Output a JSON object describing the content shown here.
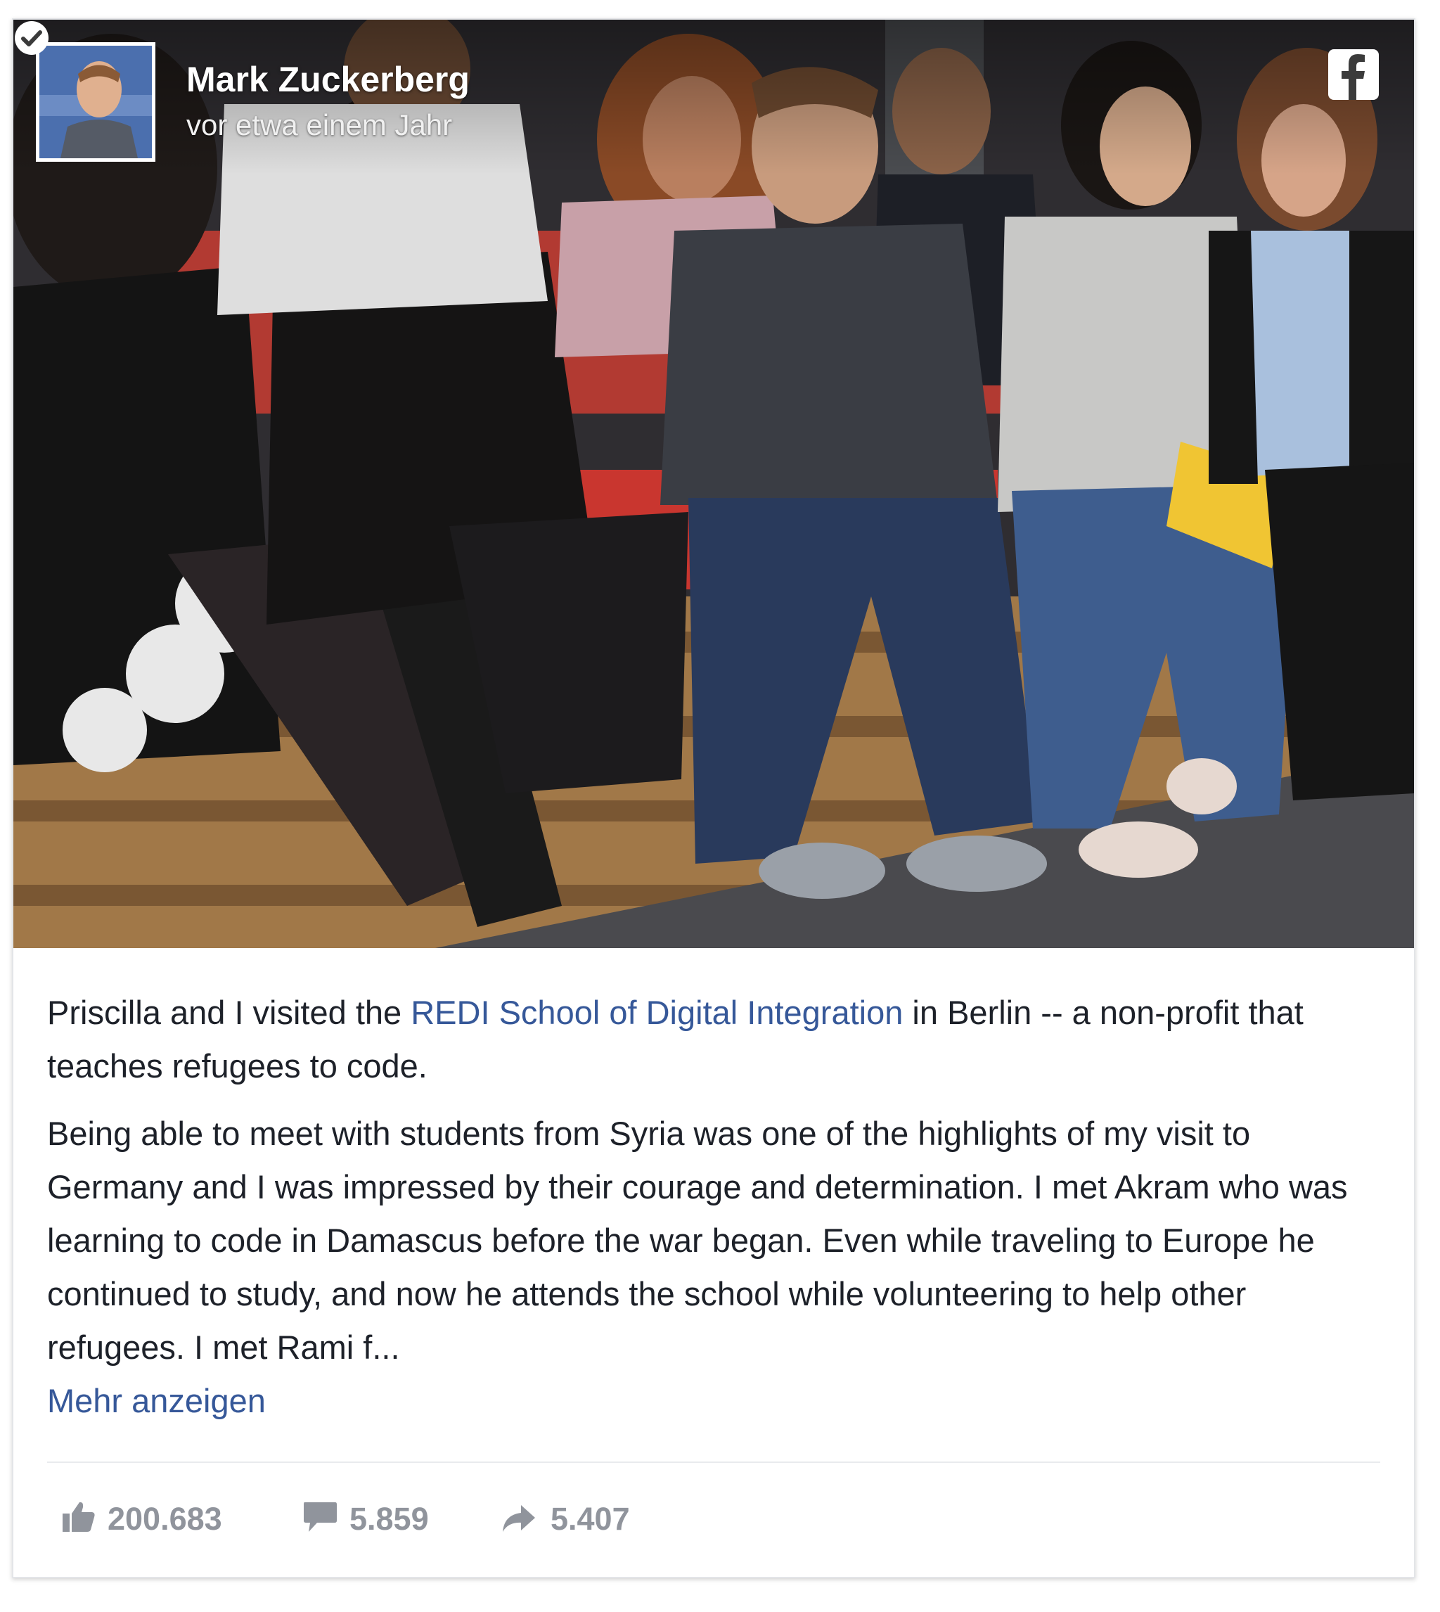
{
  "post": {
    "author": "Mark Zuckerberg",
    "time": "vor etwa einem Jahr",
    "text_before_link": "Priscilla and I visited the ",
    "link_text": "REDI School of Digital Integration",
    "text_after_link": " in Berlin -- a non-profit that teaches refugees to code.",
    "paragraph2": "Being able to meet with students from Syria was one of the highlights of my visit to Germany and I was impressed by their courage and determination. I met Akram who was learning to code in Damascus before the war began. Even while traveling to Europe he continued to study, and now he attends the school while volunteering to help other refugees. I met Rami f...",
    "more_label": "Mehr anzeigen"
  },
  "stats": {
    "likes": "200.683",
    "comments": "5.859",
    "shares": "5.407"
  },
  "colors": {
    "link": "#365899",
    "text": "#1d2129",
    "muted": "#90949c"
  }
}
